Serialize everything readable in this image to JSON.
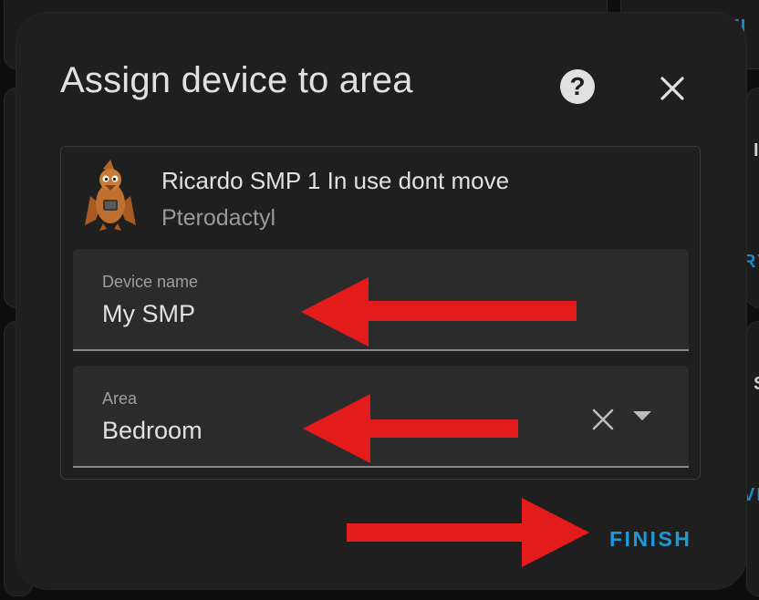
{
  "dialog": {
    "title": "Assign device to area",
    "help_icon": "question-mark-circle-icon",
    "close_icon": "close-x-icon"
  },
  "device": {
    "name": "Ricardo SMP 1 In use dont move",
    "model": "Pterodactyl",
    "image_icon": "pterodactyl-mascot-image"
  },
  "fields": {
    "device_name": {
      "label": "Device name",
      "value": "My SMP"
    },
    "area": {
      "label": "Area",
      "value": "Bedroom",
      "clear_icon": "clear-x-icon",
      "dropdown_icon": "caret-down-icon"
    }
  },
  "actions": {
    "finish_label": "FINISH"
  },
  "colors": {
    "dialog_bg": "#1f1f1f",
    "field_bg": "#2b2b2b",
    "accent": "#1e9bd7",
    "annotation_arrow": "#e31b1b",
    "text_primary": "#e1e1e1",
    "text_secondary": "#9a9a9a"
  },
  "background": {
    "partial_texts": [
      "ITI",
      "RY",
      "S",
      "VI",
      "I"
    ]
  }
}
